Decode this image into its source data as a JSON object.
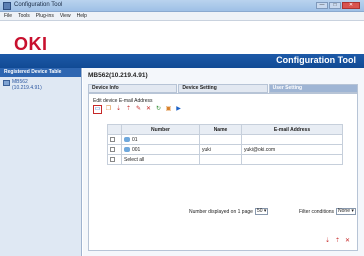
{
  "window": {
    "title": "Configuration Tool",
    "min": "—",
    "max": "□",
    "close": "✕"
  },
  "menu": [
    "File",
    "Tools",
    "Plug-ins",
    "View",
    "Help"
  ],
  "header": {
    "logo": "OKI",
    "app_name": "Configuration Tool"
  },
  "sidebar": {
    "heading": "Registered Device Table",
    "device_name": "MB562",
    "device_ip": "(10.219.4.91)"
  },
  "main": {
    "device_title": "MB562(10.219.4.91)",
    "tabs": [
      "Device Info",
      "Device Setting",
      "User Setting"
    ],
    "active_tab": 2,
    "toolbar_caption": "Edit device E-mail Address",
    "table": {
      "headers": [
        "",
        "Number",
        "Name",
        "E-mail Address"
      ],
      "rows": [
        {
          "number": "01",
          "name": "",
          "email": ""
        },
        {
          "number": "001",
          "name": "yuki",
          "email": "yuki@oki.com"
        },
        {
          "number": "Select all",
          "name": "",
          "email": ""
        }
      ]
    },
    "pager_label": "Number displayed on 1 page",
    "pager_value": "50",
    "filter_label": "Filter conditions",
    "filter_value": "None"
  },
  "icons": {
    "toolbar": [
      "new-icon",
      "copy-icon",
      "import-icon",
      "export-icon",
      "edit-icon",
      "delete-icon",
      "refresh-icon",
      "save-icon",
      "send-icon"
    ],
    "bottom": [
      "import-icon",
      "export-icon",
      "delete-icon"
    ]
  }
}
